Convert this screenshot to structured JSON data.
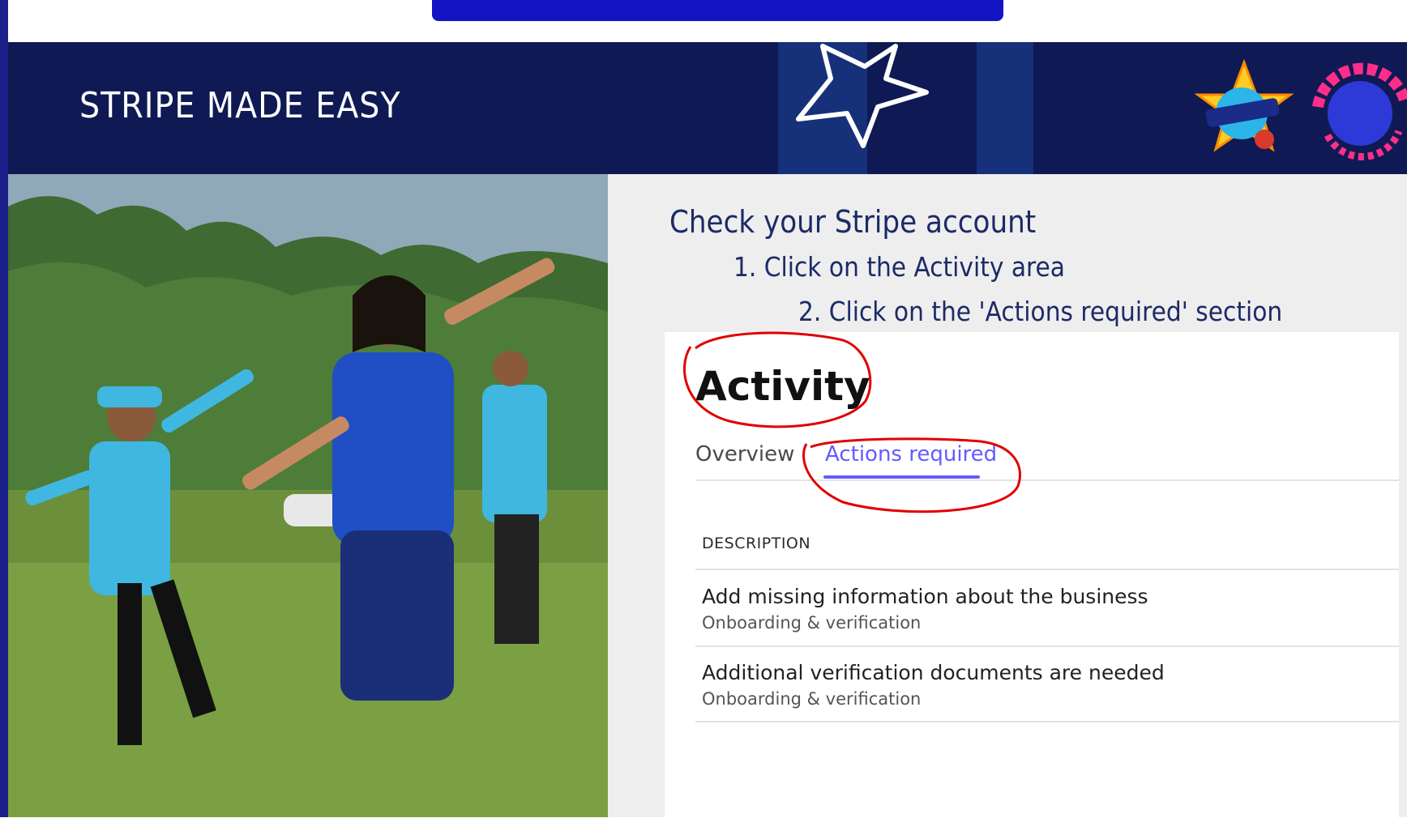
{
  "banner": {
    "title": "STRIPE MADE EASY"
  },
  "instructions": {
    "title": "Check your Stripe account",
    "step1": "1. Click on the Activity area",
    "step2": "2. Click on the 'Actions required' section"
  },
  "activity": {
    "title": "Activity",
    "tabs": [
      {
        "label": "Overview",
        "active": false
      },
      {
        "label": "Actions required",
        "active": true
      }
    ],
    "column_header": "DESCRIPTION",
    "rows": [
      {
        "title": "Add missing information about the business",
        "subtitle": "Onboarding & verification"
      },
      {
        "title": "Additional verification documents are needed",
        "subtitle": "Onboarding & verification"
      }
    ]
  },
  "colors": {
    "banner": "#0f1a54",
    "accent": "#635bff",
    "annotation": "#e00000",
    "instruction_text": "#1c2a66"
  },
  "icons": [
    "star-icon",
    "all-stars-cricket-logo",
    "dynamos-cricket-logo"
  ]
}
